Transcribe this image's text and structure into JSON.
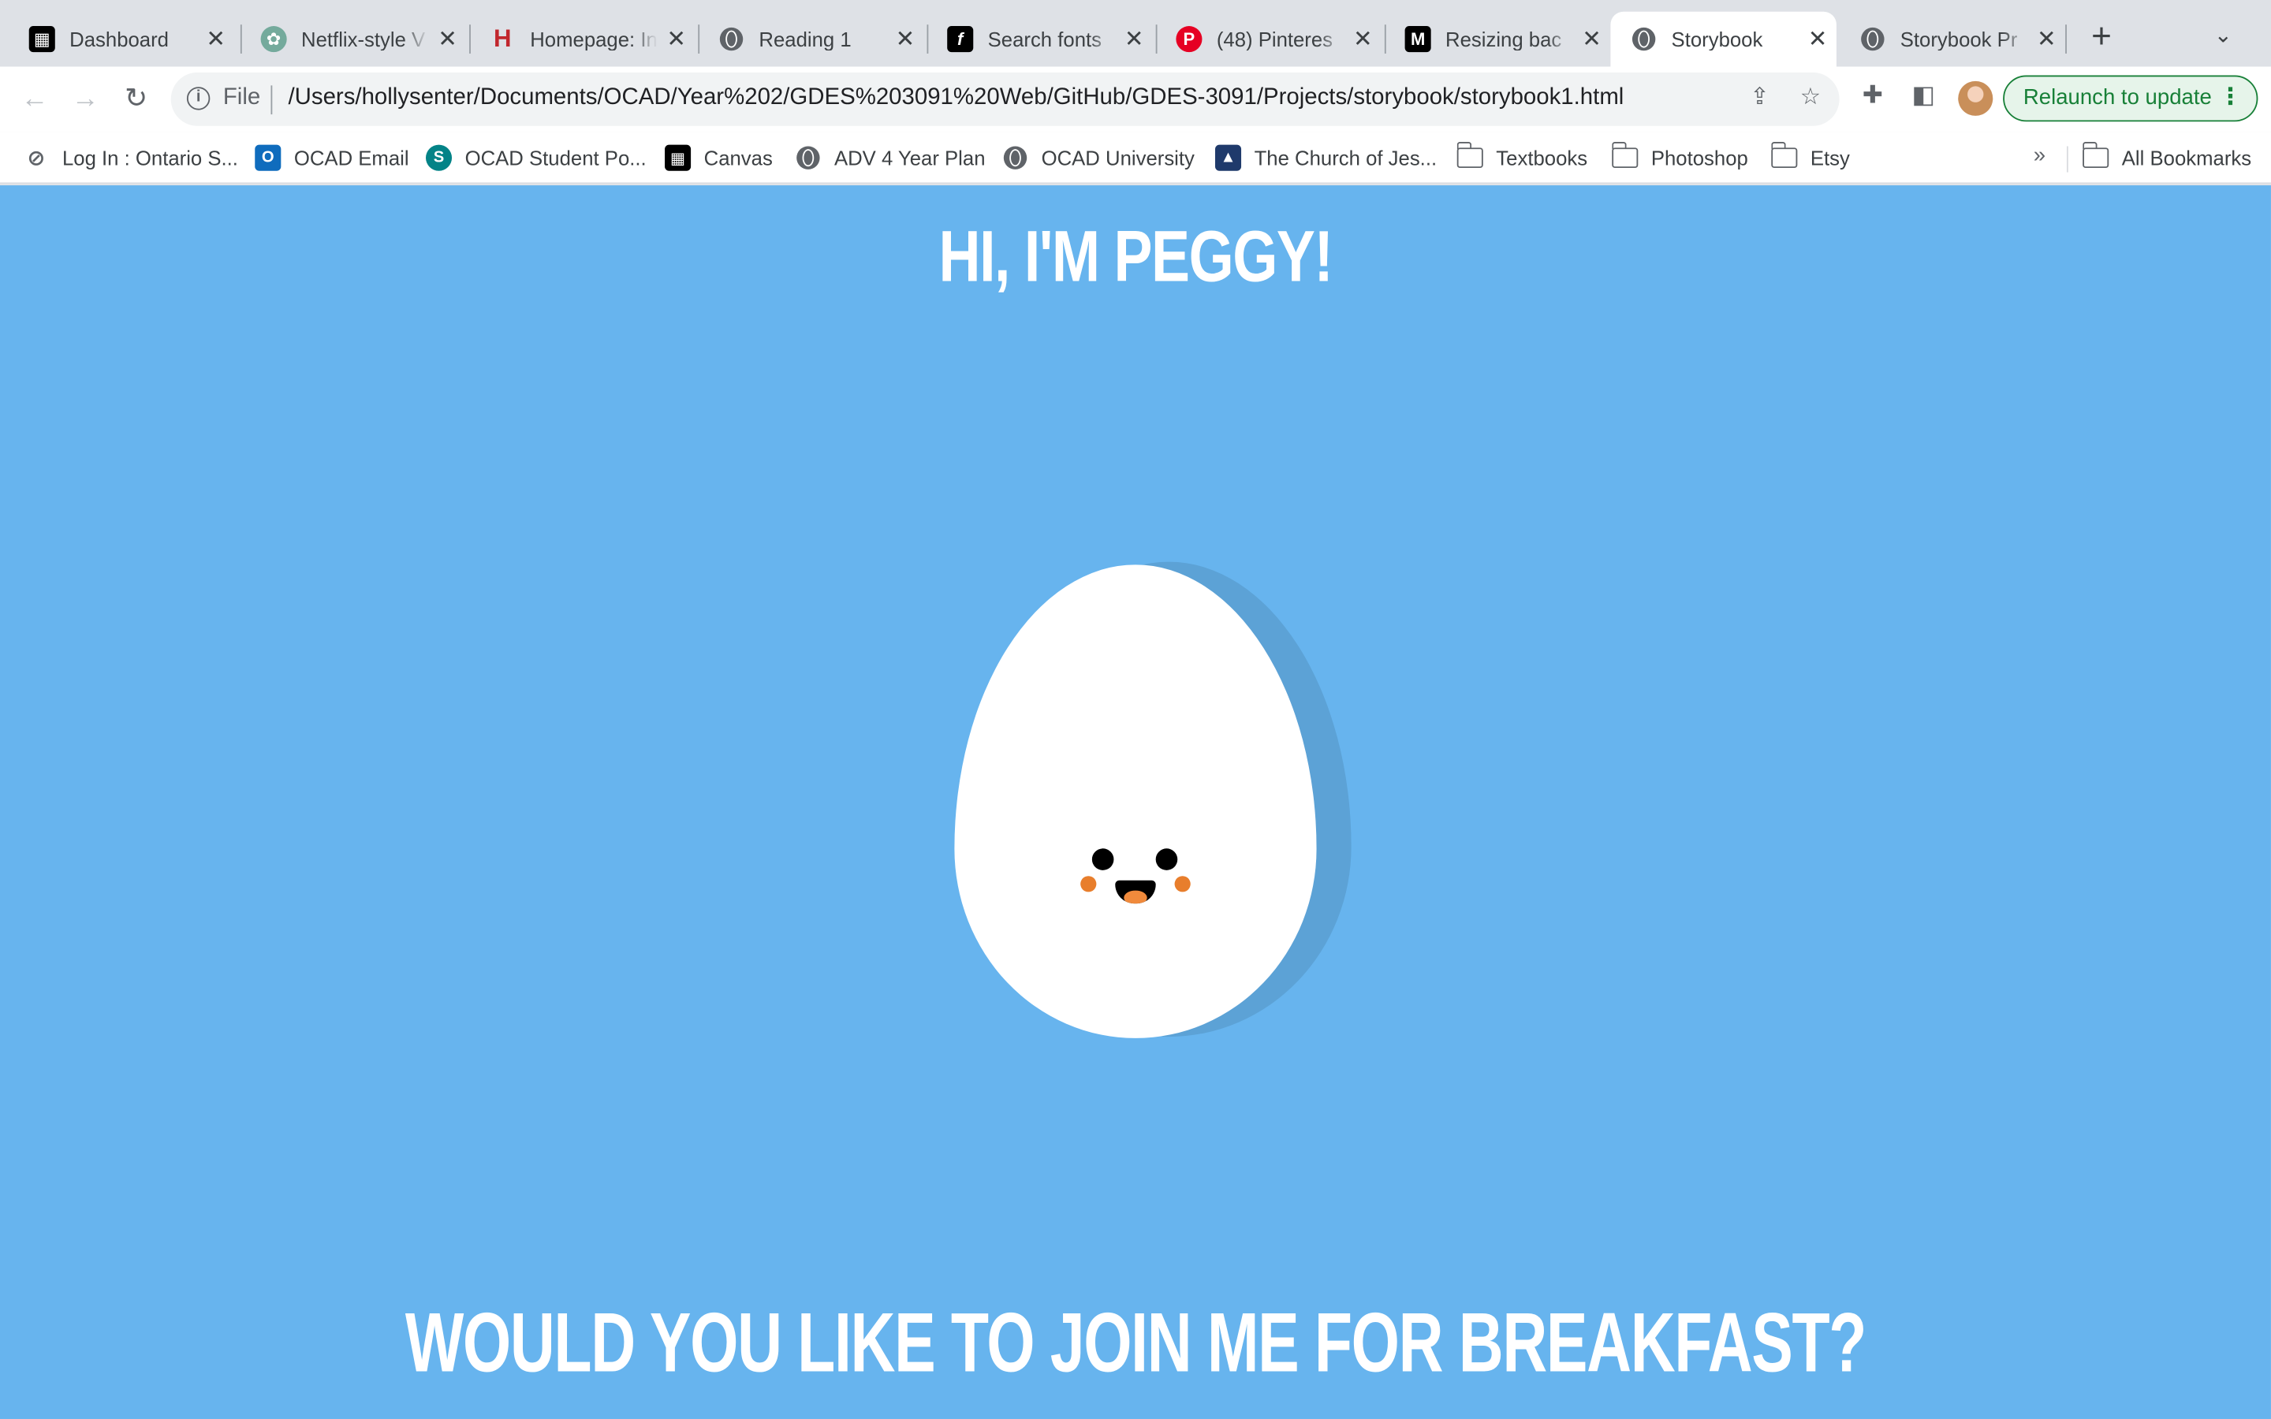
{
  "browser": {
    "tabs": [
      {
        "title": "Dashboard",
        "icon": "canvas-icon",
        "color": "#000000"
      },
      {
        "title": "Netflix-style V",
        "icon": "chatgpt-icon",
        "color": "#74aa9c"
      },
      {
        "title": "Homepage: In",
        "icon": "h-logo-icon",
        "color": "#c1272d"
      },
      {
        "title": "Reading 1",
        "icon": "globe-icon",
        "color": "#5f6368"
      },
      {
        "title": "Search fonts",
        "icon": "fonts-icon",
        "color": "#000000"
      },
      {
        "title": "(48) Pinteres",
        "icon": "pinterest-icon",
        "color": "#e60023"
      },
      {
        "title": "Resizing bac",
        "icon": "medium-icon",
        "color": "#000000"
      },
      {
        "title": "Storybook",
        "icon": "globe-icon",
        "color": "#5f6368",
        "active": true
      },
      {
        "title": "Storybook Pr",
        "icon": "globe-icon",
        "color": "#5f6368"
      }
    ],
    "address": {
      "scheme_label": "File",
      "url": "/Users/hollysenter/Documents/OCAD/Year%202/GDES%203091%20Web/GitHub/GDES-3091/Projects/storybook/storybook1.html"
    },
    "relaunch_label": "Relaunch to update",
    "bookmarks": [
      {
        "label": "Log In : Ontario S...",
        "icon": "ontario-icon"
      },
      {
        "label": "OCAD Email",
        "icon": "outlook-icon"
      },
      {
        "label": "OCAD Student Po...",
        "icon": "sharepoint-icon"
      },
      {
        "label": "Canvas",
        "icon": "canvas-icon"
      },
      {
        "label": "ADV 4 Year Plan",
        "icon": "globe-icon"
      },
      {
        "label": "OCAD University",
        "icon": "globe-icon"
      },
      {
        "label": "The Church of Jes...",
        "icon": "church-icon"
      },
      {
        "label": "Textbooks",
        "icon": "folder-icon"
      },
      {
        "label": "Photoshop",
        "icon": "folder-icon"
      },
      {
        "label": "Etsy",
        "icon": "folder-icon"
      }
    ],
    "overflow_label": "»",
    "all_bookmarks_label": "All Bookmarks"
  },
  "page": {
    "background": "#67b4ee",
    "greeting": "HI, I'M PEGGY!",
    "question": "WOULD YOU LIKE TO JOIN ME FOR BREAKFAST?",
    "character": {
      "name": "egg-character",
      "cheek_color": "#e87e2c"
    }
  }
}
